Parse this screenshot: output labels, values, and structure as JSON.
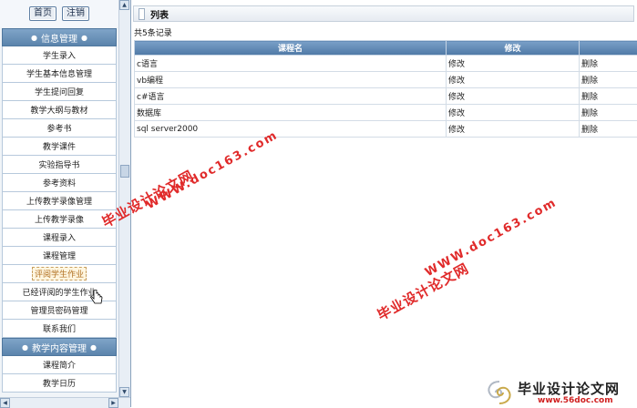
{
  "top_buttons": {
    "home": "首页",
    "logout": "注销"
  },
  "sections": [
    {
      "title": "信息管理",
      "items": [
        "学生录入",
        "学生基本信息管理",
        "学生提问回复",
        "教学大纲与教材",
        "参考书",
        "教学课件",
        "实验指导书",
        "参考资料",
        "上传教学录像管理",
        "上传教学录像",
        "课程录入",
        "课程管理",
        "评阅学生作业",
        "已经评阅的学生作业",
        "管理员密码管理",
        "联系我们"
      ]
    },
    {
      "title": "教学内容管理",
      "items": [
        "课程简介",
        "教学日历"
      ]
    }
  ],
  "panel": {
    "title": "列表",
    "record_count": "共5条记录",
    "columns": [
      "课程名",
      "修改",
      ""
    ],
    "rows": [
      {
        "name": "c语言",
        "edit": "修改",
        "delete": "删除"
      },
      {
        "name": "vb编程",
        "edit": "修改",
        "delete": "删除"
      },
      {
        "name": "c#语言",
        "edit": "修改",
        "delete": "删除"
      },
      {
        "name": "数据库",
        "edit": "修改",
        "delete": "删除"
      },
      {
        "name": "sql server2000",
        "edit": "修改",
        "delete": "删除"
      }
    ]
  },
  "watermark": {
    "cn": "毕业设计论文网",
    "url": "WWW.doc163.com"
  },
  "logo": {
    "text": "毕业设计论文网",
    "url": "www.56doc.com"
  },
  "colors": {
    "header_blue": "#5b84ac",
    "watermark_red": "#e02a2a"
  }
}
